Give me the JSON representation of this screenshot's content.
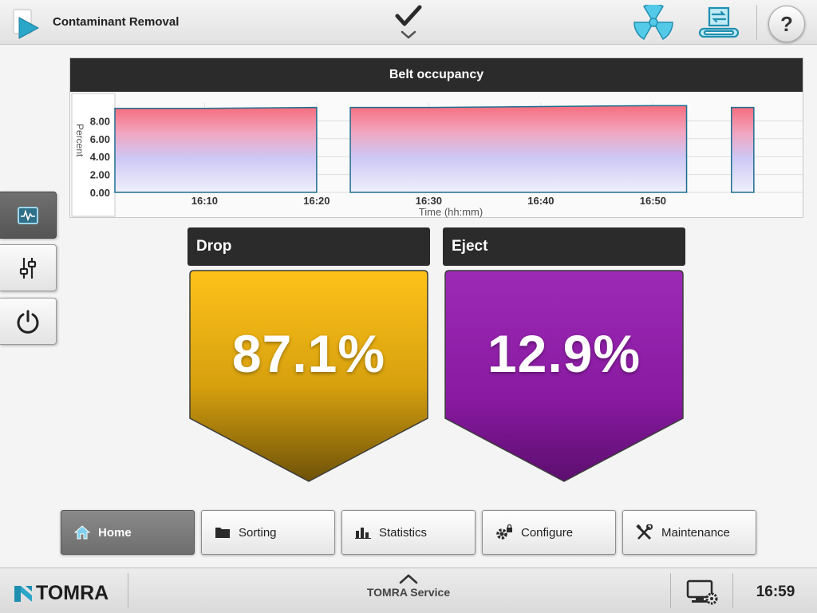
{
  "header": {
    "title": "Contaminant Removal",
    "status_icon": "checkmark-icon",
    "help_label": "?"
  },
  "side_buttons": [
    {
      "icon": "monitor-graph-icon",
      "active": true
    },
    {
      "icon": "sliders-icon",
      "active": false
    },
    {
      "icon": "power-icon",
      "active": false
    }
  ],
  "belt_chart": {
    "title": "Belt occupancy",
    "y_axis_label": "Percent",
    "x_axis_label": "Time (hh:mm)",
    "y_ticks": [
      "8.00",
      "6.00",
      "4.00",
      "2.00",
      "0.00"
    ],
    "x_ticks": [
      "16:10",
      "16:20",
      "16:30",
      "16:40",
      "16:50"
    ]
  },
  "chart_data": {
    "type": "area",
    "title": "Belt occupancy",
    "xlabel": "Time (hh:mm)",
    "ylabel": "Percent",
    "ylim": [
      0,
      10
    ],
    "x_ticks": [
      "16:10",
      "16:20",
      "16:30",
      "16:40",
      "16:50"
    ],
    "y_ticks": [
      0,
      2,
      4,
      6,
      8
    ],
    "grid": true,
    "segments": [
      {
        "x": [
          "16:02",
          "16:10",
          "16:20"
        ],
        "y": [
          9.4,
          9.4,
          9.5
        ]
      },
      {
        "x": [
          "16:23",
          "16:30",
          "16:40",
          "16:50",
          "16:53"
        ],
        "y": [
          9.5,
          9.5,
          9.6,
          9.7,
          9.7
        ]
      },
      {
        "x": [
          "16:57",
          "16:59"
        ],
        "y": [
          9.5,
          9.5
        ]
      }
    ]
  },
  "metrics": {
    "drop": {
      "label": "Drop",
      "value": "87.1%",
      "color": "#c99a10"
    },
    "eject": {
      "label": "Eject",
      "value": "12.9%",
      "color": "#8e1fa3"
    }
  },
  "nav": [
    {
      "label": "Home",
      "icon": "home-icon",
      "active": true
    },
    {
      "label": "Sorting",
      "icon": "folder-icon",
      "active": false
    },
    {
      "label": "Statistics",
      "icon": "bar-chart-icon",
      "active": false
    },
    {
      "label": "Configure",
      "icon": "gear-lock-icon",
      "active": false
    },
    {
      "label": "Maintenance",
      "icon": "tools-icon",
      "active": false
    }
  ],
  "footer": {
    "brand": "TOMRA",
    "service_label": "TOMRA Service",
    "time": "16:59"
  },
  "colors": {
    "accent_teal": "#2aa6c8",
    "header_dark": "#2b2b2b",
    "chart_line": "#1e6f8f"
  }
}
